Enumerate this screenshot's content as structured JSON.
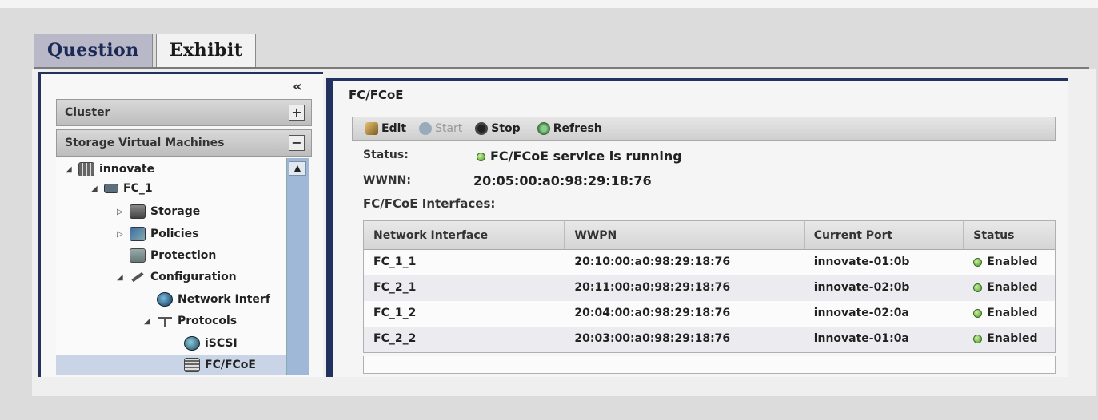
{
  "tabs": [
    {
      "label": "Question"
    },
    {
      "label": "Exhibit"
    }
  ],
  "sidebar": {
    "collapse_glyph": "«",
    "cluster_label": "Cluster",
    "cluster_toggle": "+",
    "svm_label": "Storage Virtual Machines",
    "svm_toggle": "−",
    "tree": {
      "innovate": "innovate",
      "fc1": "FC_1",
      "storage": "Storage",
      "policies": "Policies",
      "protection": "Protection",
      "configuration": "Configuration",
      "network_interf": "Network Interf",
      "protocols": "Protocols",
      "iscsi": "iSCSI",
      "fcfcoe": "FC/FCoE"
    }
  },
  "main": {
    "title": "FC/FCoE",
    "toolbar": {
      "edit": "Edit",
      "start": "Start",
      "stop": "Stop",
      "refresh": "Refresh"
    },
    "status_label": "Status:",
    "status_value": "FC/FCoE service is running",
    "wwnn_label": "WWNN:",
    "wwnn_value": "20:05:00:a0:98:29:18:76",
    "interfaces_heading": "FC/FCoE Interfaces:",
    "table": {
      "headers": [
        "Network Interface",
        "WWPN",
        "Current Port",
        "Status"
      ],
      "rows": [
        [
          "FC_1_1",
          "20:10:00:a0:98:29:18:76",
          "innovate-01:0b",
          "Enabled"
        ],
        [
          "FC_2_1",
          "20:11:00:a0:98:29:18:76",
          "innovate-02:0b",
          "Enabled"
        ],
        [
          "FC_1_2",
          "20:04:00:a0:98:29:18:76",
          "innovate-02:0a",
          "Enabled"
        ],
        [
          "FC_2_2",
          "20:03:00:a0:98:29:18:76",
          "innovate-01:0a",
          "Enabled"
        ]
      ]
    }
  }
}
